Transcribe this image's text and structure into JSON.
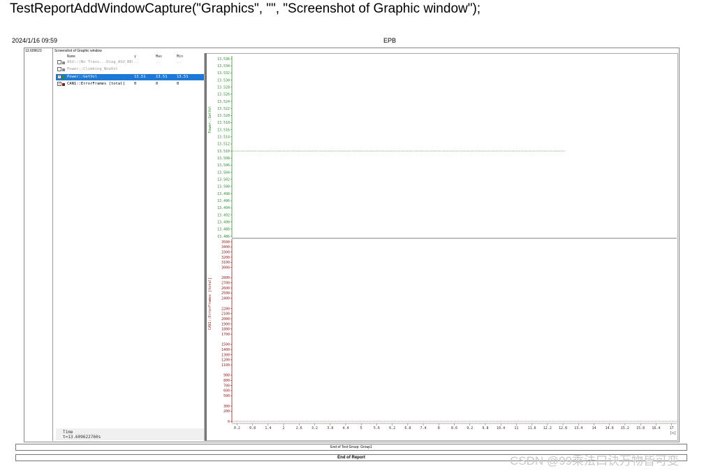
{
  "code_line": "TestReportAddWindowCapture(\"Graphics\", \"\", \"Screenshot of Graphic window\");",
  "report": {
    "date": "2024/1/16 09:59",
    "title": "EPB",
    "timestamp": "13.609623",
    "capture_title": "Screenshot of Graphic window",
    "end_group": "End of Test Group: Group1",
    "end_report": "End of Report"
  },
  "signal_list": {
    "columns": [
      "Name",
      "y",
      "Max",
      "Min"
    ],
    "rows": [
      {
        "name": "ASU::(No Trans...Diag_ASU_BE0",
        "y": "..",
        "max": "..",
        "min": "..",
        "checked": false,
        "color": "#888888",
        "selected": false,
        "dim": true
      },
      {
        "name": "Power::Climbing_NowVol",
        "y": "",
        "max": "",
        "min": "",
        "checked": false,
        "color": "#888888",
        "selected": false,
        "dim": true
      },
      {
        "name": "Power::GetVol",
        "y": "13.51",
        "max": "13.51",
        "min": "13.51",
        "checked": true,
        "color": "#2e8b2e",
        "selected": true,
        "dim": false
      },
      {
        "name": "CAN1::ErrorFrames [total]",
        "y": "0",
        "max": "0",
        "min": "0",
        "checked": true,
        "color": "#8b1a1a",
        "selected": false,
        "dim": false
      }
    ],
    "time_label": "Time",
    "time_value": "t=13.609622760s"
  },
  "colors": {
    "voltage": "#2e8b2e",
    "errors": "#8b1a1a",
    "selection": "#1e78d6"
  },
  "watermark": "CSDN @99乘法口诀万物皆可变",
  "chart_data": [
    {
      "type": "line",
      "ylabel": "Power::GetVol",
      "ylim": [
        13.486,
        13.536
      ],
      "y_ticks": [
        "13.536",
        "13.534",
        "13.532",
        "13.530",
        "13.528",
        "13.526",
        "13.524",
        "13.522",
        "13.520",
        "13.518",
        "13.516",
        "13.514",
        "13.512",
        "13.510",
        "13.508",
        "13.506",
        "13.504",
        "13.502",
        "13.500",
        "13.498",
        "13.496",
        "13.494",
        "13.492",
        "13.490",
        "13.488",
        "13.486"
      ],
      "series": [
        {
          "x": [
            0,
            12.9
          ],
          "y": [
            13.51,
            13.51
          ]
        }
      ]
    },
    {
      "type": "line",
      "ylabel": "CAN1::ErrorFrames [total]",
      "ylim": [
        0,
        3500
      ],
      "y_ticks": [
        "3500",
        "3400",
        "3300",
        "3200",
        "3100",
        "3000",
        "2800",
        "2700",
        "2600",
        "2500",
        "2400",
        "2200",
        "2100",
        "2000",
        "1900",
        "1800",
        "1700",
        "1500",
        "1400",
        "1300",
        "1200",
        "1100",
        "900",
        "800",
        "700",
        "600",
        "500",
        "300",
        "200",
        "0"
      ],
      "series": [
        {
          "x": [
            0,
            17.2
          ],
          "y": [
            0,
            0
          ]
        }
      ]
    }
  ],
  "x_axis": {
    "xlim": [
      0,
      17.2
    ],
    "ticks": [
      "0.2",
      "0.8",
      "1.4",
      "2",
      "2.6",
      "3.2",
      "3.8",
      "4.4",
      "5",
      "5.6",
      "6.2",
      "6.8",
      "7.4",
      "8",
      "8.6",
      "9.2",
      "9.8",
      "10.4",
      "11",
      "11.6",
      "12.2",
      "12.8",
      "13.4",
      "14",
      "14.6",
      "15.2",
      "15.8",
      "16.4",
      "17"
    ],
    "unit": "[s]"
  }
}
